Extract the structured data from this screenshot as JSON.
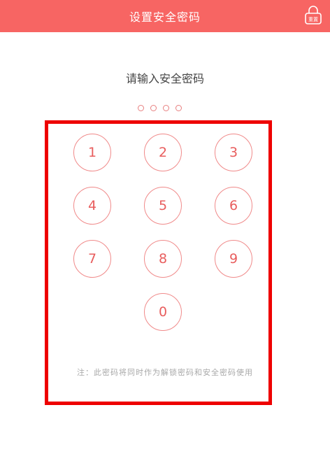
{
  "header": {
    "title": "设置安全密码",
    "icon": "lock-icon",
    "icon_text": "重置"
  },
  "prompt": "请输入安全密码",
  "pin_dots": [
    false,
    false,
    false,
    false
  ],
  "keypad": {
    "keys": [
      "1",
      "2",
      "3",
      "4",
      "5",
      "6",
      "7",
      "8",
      "9",
      "0"
    ]
  },
  "note": "注：此密码将同时作为解锁密码和安全密码使用",
  "colors": {
    "header_bg": "#f76563",
    "key_border": "#f08a8a",
    "key_text": "#e85d5d",
    "highlight_frame": "#ee0000"
  }
}
